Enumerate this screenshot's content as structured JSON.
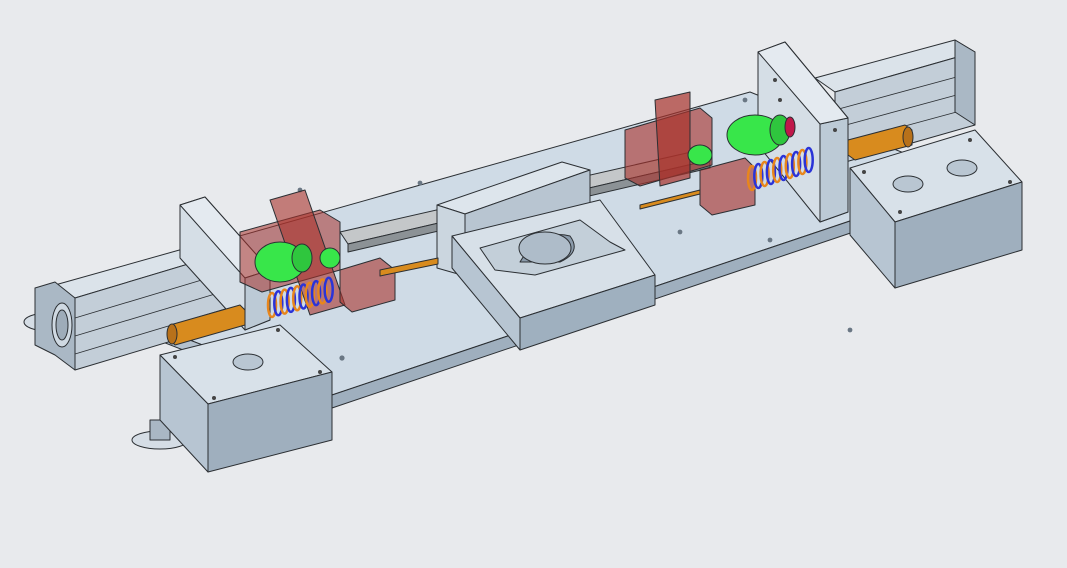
{
  "viewport": {
    "background": "#e8eaed"
  },
  "colors": {
    "steel_light": "#cfdbe6",
    "steel_mid": "#b6c5d2",
    "steel_dark": "#8b9bab",
    "edge": "#2b2f33",
    "clamp_red": "#a8322b",
    "motor_green": "#38e64a",
    "spring_orange": "#e8861c",
    "spring_blue": "#2a33d8",
    "rod_orange": "#d88b1e"
  },
  "parts": {
    "base_plate": "base-plate",
    "left_cylinder": "pneumatic-cylinder",
    "right_cylinder": "pneumatic-cylinder",
    "left_block": "mounting-block",
    "right_block": "mounting-block",
    "center_die": "die-block",
    "left_clamp": "clamp-carriage",
    "right_clamp": "clamp-carriage",
    "linear_rail": "linear-guide-rail",
    "feet": "leveling-foot"
  }
}
